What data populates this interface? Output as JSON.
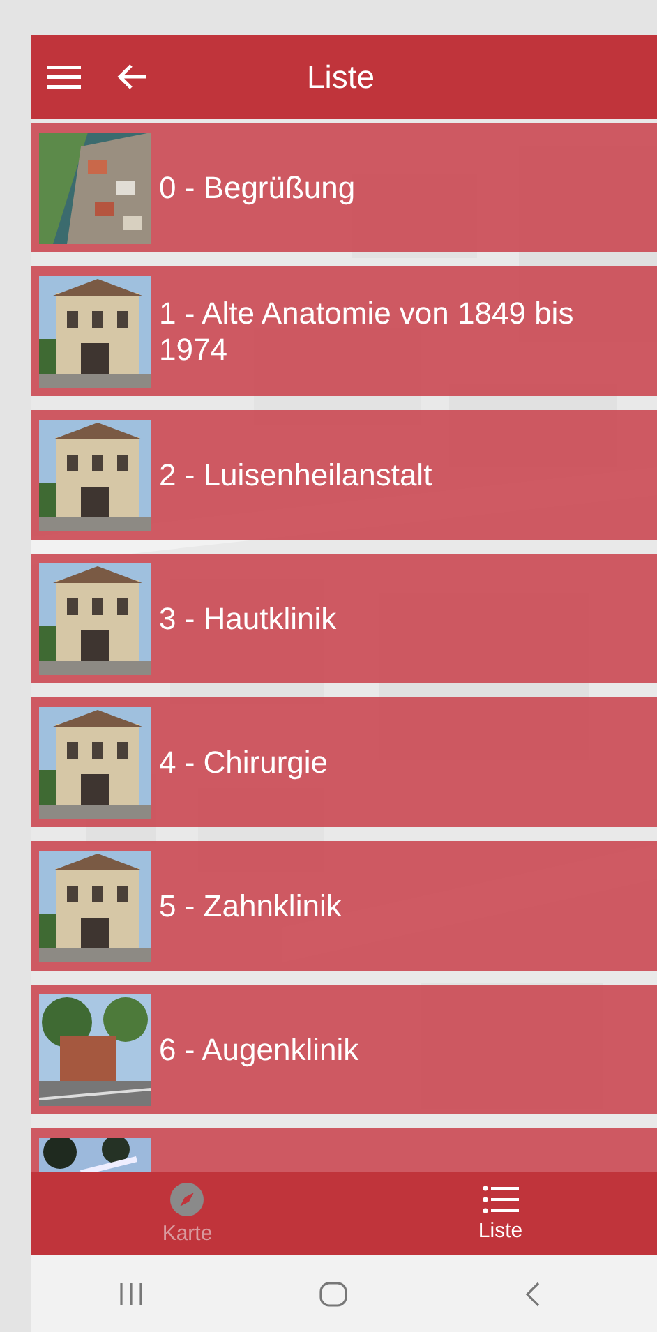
{
  "header": {
    "title": "Liste"
  },
  "items": [
    {
      "label": "0 - Begrüßung",
      "kind": "aerial"
    },
    {
      "label": "1 - Alte Anatomie von 1849 bis 1974",
      "kind": "building"
    },
    {
      "label": "2 - Luisenheilanstalt",
      "kind": "building"
    },
    {
      "label": "3 - Hautklinik",
      "kind": "building"
    },
    {
      "label": "4 - Chirurgie",
      "kind": "building"
    },
    {
      "label": "5 - Zahnklinik",
      "kind": "building"
    },
    {
      "label": "6 - Augenklinik",
      "kind": "street"
    }
  ],
  "bottom_nav": [
    {
      "label": "Karte",
      "kind": "compass",
      "selected": false
    },
    {
      "label": "Liste",
      "kind": "list",
      "selected": true
    }
  ]
}
